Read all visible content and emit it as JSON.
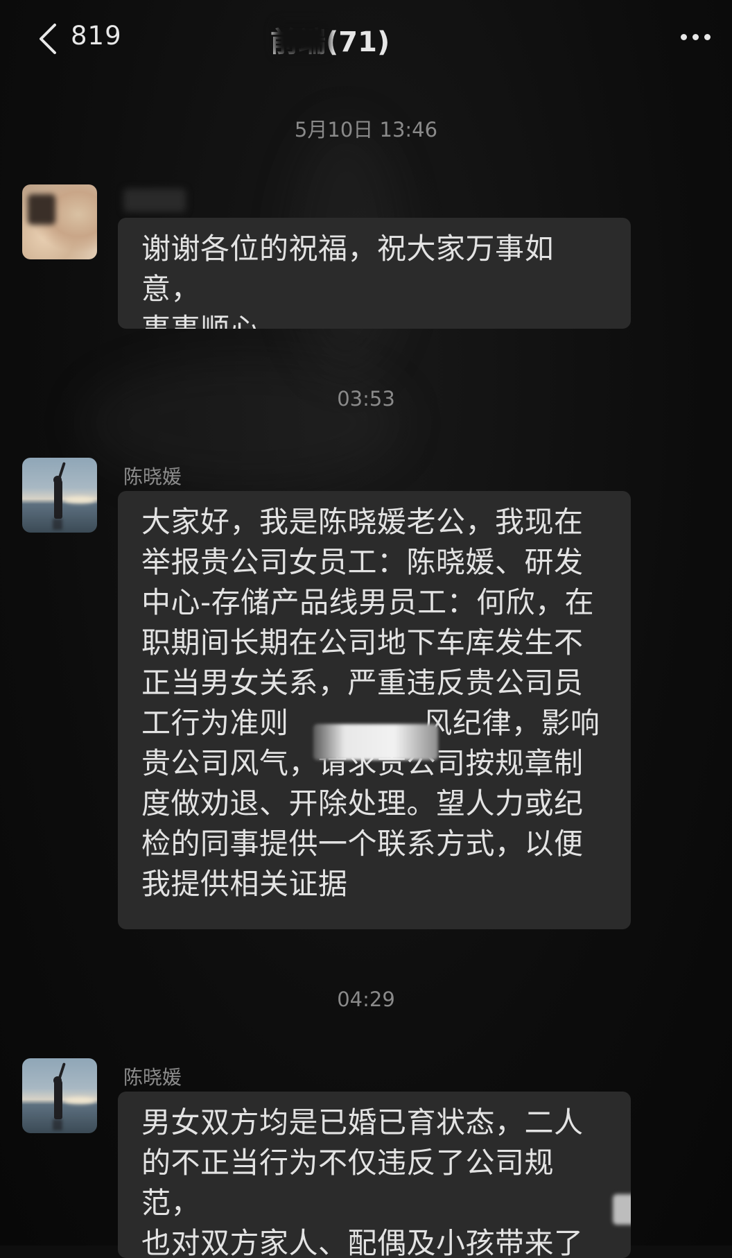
{
  "header": {
    "back_count": "819",
    "title": "前端(71)"
  },
  "timestamps": {
    "t1": "5月10日 13:46",
    "t2": "03:53",
    "t3": "04:29"
  },
  "messages": [
    {
      "sender": "",
      "text": "谢谢各位的祝福，祝大家万事如意，\n事事顺心"
    },
    {
      "sender": "陈晓媛",
      "text": "大家好，我是陈晓媛老公，我现在\n举报贵公司女员工：陈晓媛、研发\n中心-存储产品线男员工：何欣，在\n职期间长期在公司地下车库发生不\n正当男女关系，严重违反贵公司员\n工行为准则              风纪律，影响\n贵公司风气，请求贵公司按规章制\n度做劝退、开除处理。望人力或纪\n检的同事提供一个联系方式，以便\n我提供相关证据"
    },
    {
      "sender": "陈晓媛",
      "text": "男女双方均是已婚已育状态，二人\n的不正当行为不仅违反了公司规范，\n也对双方家人、配偶及小孩带来了\n不可弥补的精神伤害，尤其严重的"
    }
  ],
  "icons": {
    "back": "chevron-left-icon",
    "more": "more-dots-icon"
  },
  "colors": {
    "background": "#0e0e0e",
    "bubble": "#2b2b2b",
    "text": "#e3e3e3",
    "timestamp": "#8a8a8a"
  }
}
